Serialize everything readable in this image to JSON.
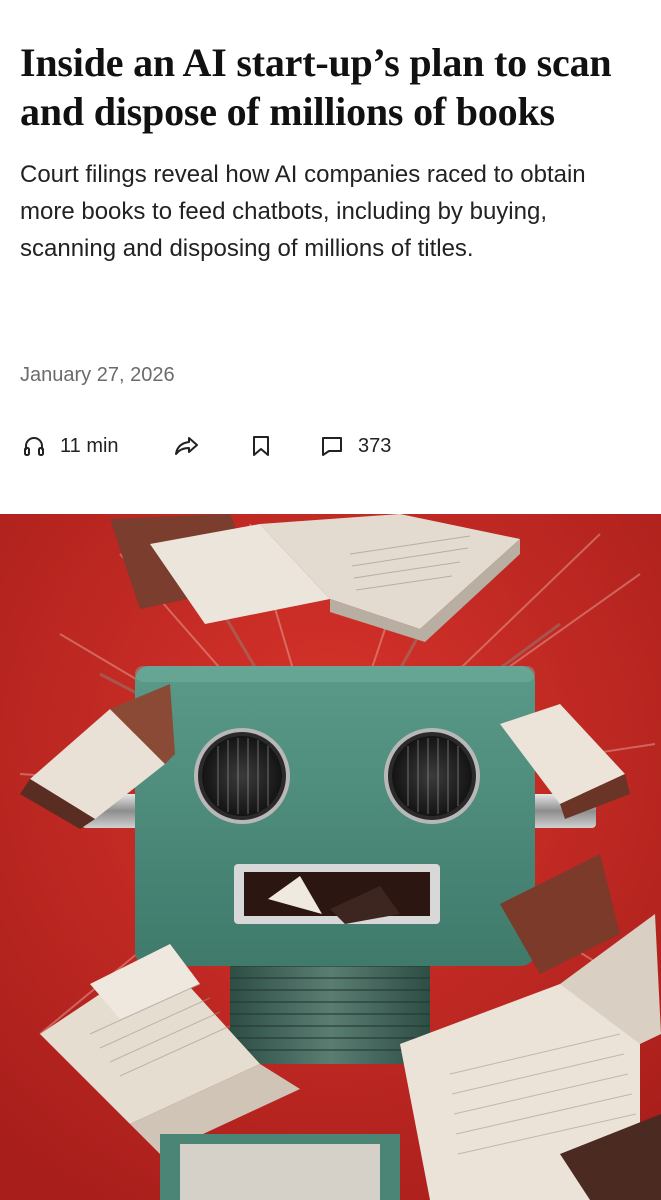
{
  "article": {
    "headline": "Inside an AI start-up’s plan to scan and dispose of millions of books",
    "dek": "Court filings reveal how AI companies raced to obtain more books to feed chatbots, including by buying, scanning and disposing of millions of titles.",
    "date": "January 27, 2026"
  },
  "actions": {
    "listen": {
      "icon": "headphones-icon",
      "label": "11 min"
    },
    "share": {
      "icon": "share-arrow-icon"
    },
    "save": {
      "icon": "bookmark-icon"
    },
    "comments": {
      "icon": "comment-icon",
      "count": "373"
    }
  },
  "hero_image": {
    "subject": "illustration",
    "colors": {
      "background": "#cc2b24",
      "robot": "#4c8a7a",
      "pages": "#e9e3dc"
    }
  }
}
